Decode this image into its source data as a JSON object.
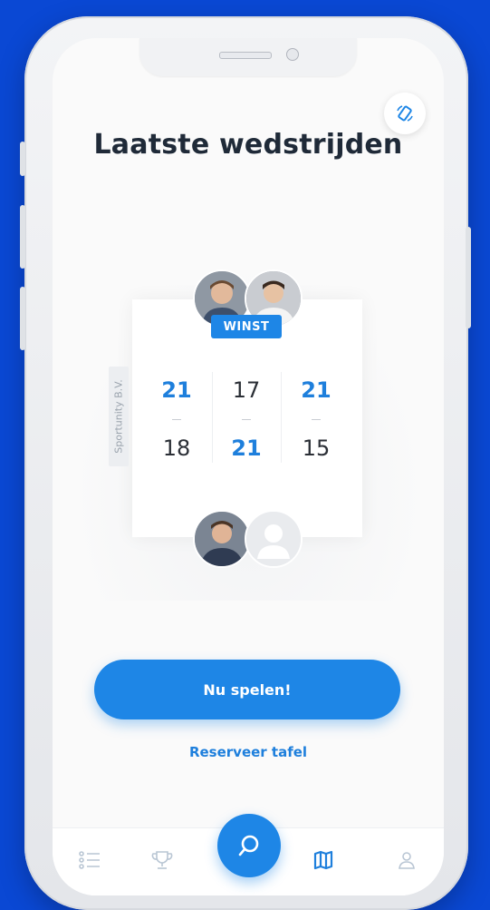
{
  "screen": {
    "title": "Laatste wedstrijden"
  },
  "match": {
    "result_badge": "WINST",
    "venue": "Sportunity B.V.",
    "sets": [
      {
        "top": "21",
        "bottom": "18",
        "winner": "top"
      },
      {
        "top": "17",
        "bottom": "21",
        "winner": "bottom"
      },
      {
        "top": "21",
        "bottom": "15",
        "winner": "top"
      }
    ]
  },
  "actions": {
    "play_label": "Nu spelen!",
    "reserve_label": "Reserveer tafel"
  },
  "tabbar": {
    "tabs": [
      "list-icon",
      "trophy-icon",
      "search-icon",
      "map-icon",
      "profile-icon"
    ],
    "active": "map-icon"
  },
  "colors": {
    "accent": "#1e86e6",
    "background": "#0a48d4",
    "title": "#1f2a38"
  }
}
